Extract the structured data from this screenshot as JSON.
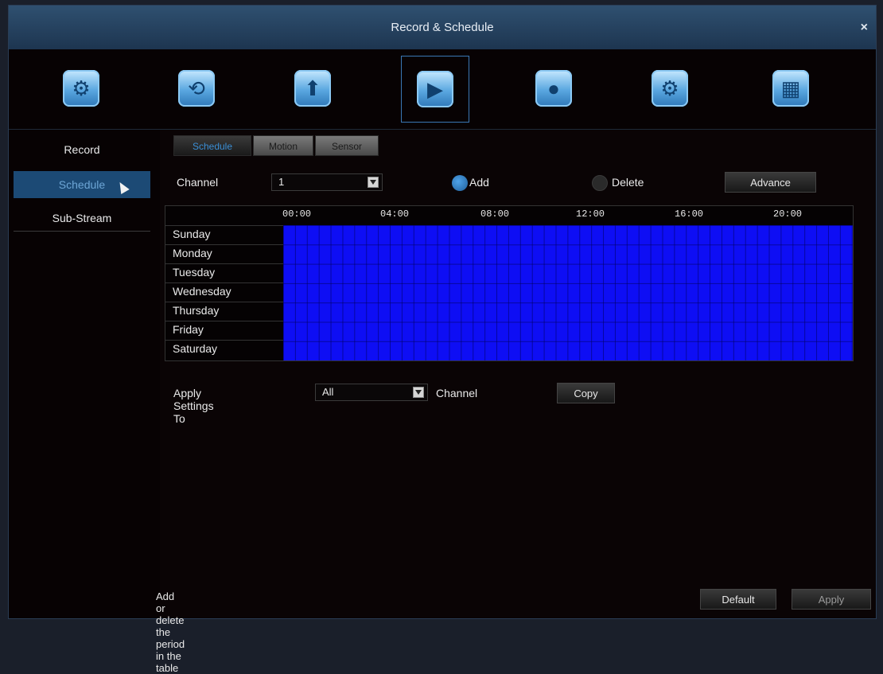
{
  "window": {
    "title": "Record & Schedule",
    "close_label": "×"
  },
  "toolbar": {
    "tools": [
      {
        "icon": "settings-gear-icon",
        "glyph": "⚙"
      },
      {
        "icon": "playback-icon",
        "glyph": "⟲"
      },
      {
        "icon": "upload-icon",
        "glyph": "⬆"
      },
      {
        "icon": "camera-record-icon",
        "glyph": "▶"
      },
      {
        "icon": "alarm-siren-icon",
        "glyph": "●"
      },
      {
        "icon": "advanced-settings-icon",
        "glyph": "⚙"
      },
      {
        "icon": "info-icon",
        "glyph": "▦"
      }
    ],
    "active_index": 3
  },
  "sidebar": {
    "items": [
      {
        "label": "Record"
      },
      {
        "label": "Schedule"
      },
      {
        "label": "Sub-Stream"
      }
    ],
    "selected_index": 1
  },
  "tabs": [
    {
      "label": "Schedule"
    },
    {
      "label": "Motion"
    },
    {
      "label": "Sensor"
    }
  ],
  "channel": {
    "label": "Channel",
    "value": "1"
  },
  "mode": {
    "add_label": "Add",
    "delete_label": "Delete",
    "selected": "Add"
  },
  "advance_button": "Advance",
  "schedule": {
    "hours": [
      "00:00",
      "04:00",
      "08:00",
      "12:00",
      "16:00",
      "20:00"
    ],
    "days": [
      "Sunday",
      "Monday",
      "Tuesday",
      "Wednesday",
      "Thursday",
      "Friday",
      "Saturday"
    ],
    "fill_color": "#0e0ef4",
    "all_selected": true
  },
  "apply_settings": {
    "label": "Apply Settings To",
    "value": "All",
    "suffix": "Channel",
    "copy_label": "Copy"
  },
  "footer": {
    "hint": "Add or delete the period in the table",
    "default_label": "Default",
    "apply_label": "Apply"
  }
}
